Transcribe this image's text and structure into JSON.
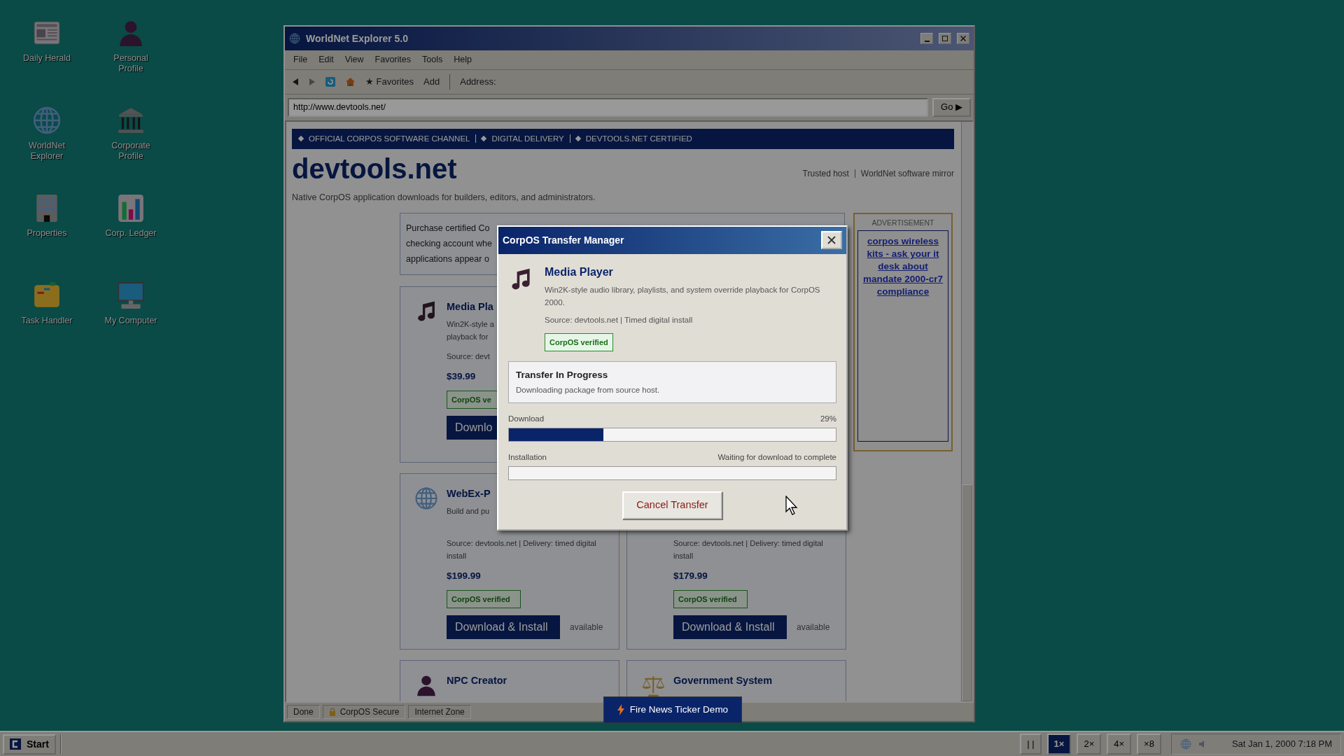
{
  "desktop_icons": [
    {
      "label": "Daily Herald"
    },
    {
      "label": "Personal Profile"
    },
    {
      "label": "WorldNet Explorer"
    },
    {
      "label": "Corporate Profile"
    },
    {
      "label": "Properties"
    },
    {
      "label": "Corp. Ledger"
    },
    {
      "label": "Task Handler"
    },
    {
      "label": "My Computer"
    }
  ],
  "browser": {
    "title": "WorldNet Explorer 5.0",
    "menu": [
      "File",
      "Edit",
      "View",
      "Favorites",
      "Tools",
      "Help"
    ],
    "toolbar": {
      "favorites": "★ Favorites",
      "add": "Add",
      "address_label": "Address:"
    },
    "address": "http://www.devtools.net/",
    "go": "Go ▶",
    "page": {
      "banner": [
        "OFFICIAL CORPOS SOFTWARE CHANNEL",
        "DIGITAL DELIVERY",
        "DEVTOOLS.NET CERTIFIED"
      ],
      "site_title": "devtools.net",
      "header_links": [
        "Trusted host",
        "WorldNet software mirror"
      ],
      "tagline": "Native CorpOS application downloads for builders, editors, and administrators.",
      "notice_lines": [
        "Purchase certified Co",
        "checking account whe",
        "applications appear o"
      ],
      "ad": {
        "label": "ADVERTISEMENT",
        "text": "corpos wireless kits - ask your it desk about mandate 2000-cr7 compliance"
      },
      "product_rows": [
        [
          {
            "title": "Media Pla",
            "description": [
              "Win2K-style a",
              "playback for"
            ],
            "source": "Source: devt",
            "price": "$39.99",
            "badge": "CorpOS ve",
            "button": "Downlo"
          }
        ],
        [
          {
            "title": "WebEx-P",
            "description": [
              "Build and pu"
            ],
            "source": "Source: devtools.net  |  Delivery: timed digital install",
            "price": "$199.99",
            "badge": "CorpOS verified",
            "button": "Download & Install",
            "availability": "available"
          },
          {
            "source": "Source: devtools.net  |  Delivery: timed digital install",
            "price": "$179.99",
            "badge": "CorpOS verified",
            "button": "Download & Install",
            "availability": "available"
          }
        ],
        [
          {
            "title": "NPC Creator"
          },
          {
            "title": "Government System"
          }
        ]
      ]
    },
    "status_bar": [
      "Done",
      "CorpOS Secure",
      "Internet Zone"
    ]
  },
  "transfer_dialog": {
    "title": "CorpOS Transfer Manager",
    "product": {
      "name": "Media Player",
      "description": "Win2K-style audio library, playlists, and system override playback for CorpOS 2000.",
      "source": "Source: devtools.net | Timed digital install",
      "badge": "CorpOS verified"
    },
    "status": {
      "title": "Transfer In Progress",
      "message": "Downloading package from source host."
    },
    "progress": [
      {
        "label": "Download",
        "reading": "29%",
        "level": 0.29
      },
      {
        "label": "Installation",
        "reading": "Waiting for download to complete",
        "level": 0
      }
    ],
    "button": "Cancel Transfer"
  },
  "ticker_button": "Fire News Ticker Demo",
  "taskbar": {
    "start": "Start",
    "speed_buttons": [
      {
        "label": "| |",
        "selected": false
      },
      {
        "label": "1×",
        "selected": true
      },
      {
        "label": "2×",
        "selected": false
      },
      {
        "label": "4×",
        "selected": false
      },
      {
        "label": "×8",
        "selected": false
      }
    ],
    "clock": "Sat Jan 1, 2000 7:18 PM"
  }
}
